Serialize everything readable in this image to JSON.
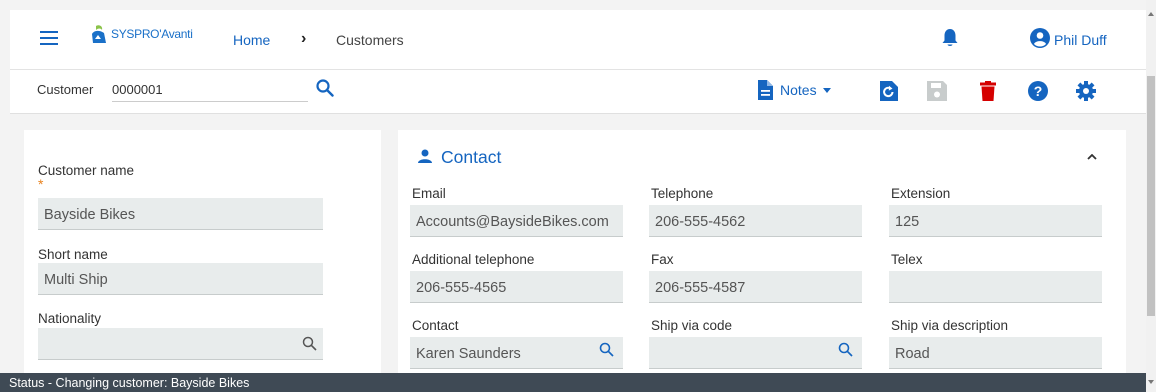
{
  "header": {
    "logo_text": "SYSPRO",
    "logo_suffix": "Avanti",
    "breadcrumb": [
      "Home",
      "Customers"
    ],
    "user_name": "Phil Duff"
  },
  "toolbar": {
    "customer_label": "Customer",
    "customer_value": "0000001",
    "notes_label": "Notes"
  },
  "left_panel": {
    "customer_name_label": "Customer name",
    "required_marker": "*",
    "customer_name_value": "Bayside Bikes",
    "short_name_label": "Short name",
    "short_name_value": "Multi Ship",
    "nationality_label": "Nationality",
    "nationality_value": ""
  },
  "contact": {
    "title": "Contact",
    "email_label": "Email",
    "email_value": "Accounts@BaysideBikes.com",
    "telephone_label": "Telephone",
    "telephone_value": "206-555-4562",
    "extension_label": "Extension",
    "extension_value": "125",
    "add_tel_label": "Additional telephone",
    "add_tel_value": "206-555-4565",
    "fax_label": "Fax",
    "fax_value": "206-555-4587",
    "telex_label": "Telex",
    "telex_value": "",
    "contact_label": "Contact",
    "contact_value": "Karen Saunders",
    "ship_code_label": "Ship via code",
    "ship_code_value": "",
    "ship_desc_label": "Ship via description",
    "ship_desc_value": "Road"
  },
  "status_bar": {
    "text": "Status - Changing customer: Bayside Bikes"
  },
  "colors": {
    "accent": "#1565c0",
    "delete": "#d50000",
    "required": "#e8821e",
    "status_bg": "#3f4a55"
  },
  "icons": [
    "hamburger-icon",
    "bell-icon",
    "account-circle-icon",
    "search-icon",
    "notes-file-icon",
    "refresh-icon",
    "save-icon",
    "delete-icon",
    "help-icon",
    "settings-icon",
    "person-icon",
    "chevron-up-icon"
  ]
}
